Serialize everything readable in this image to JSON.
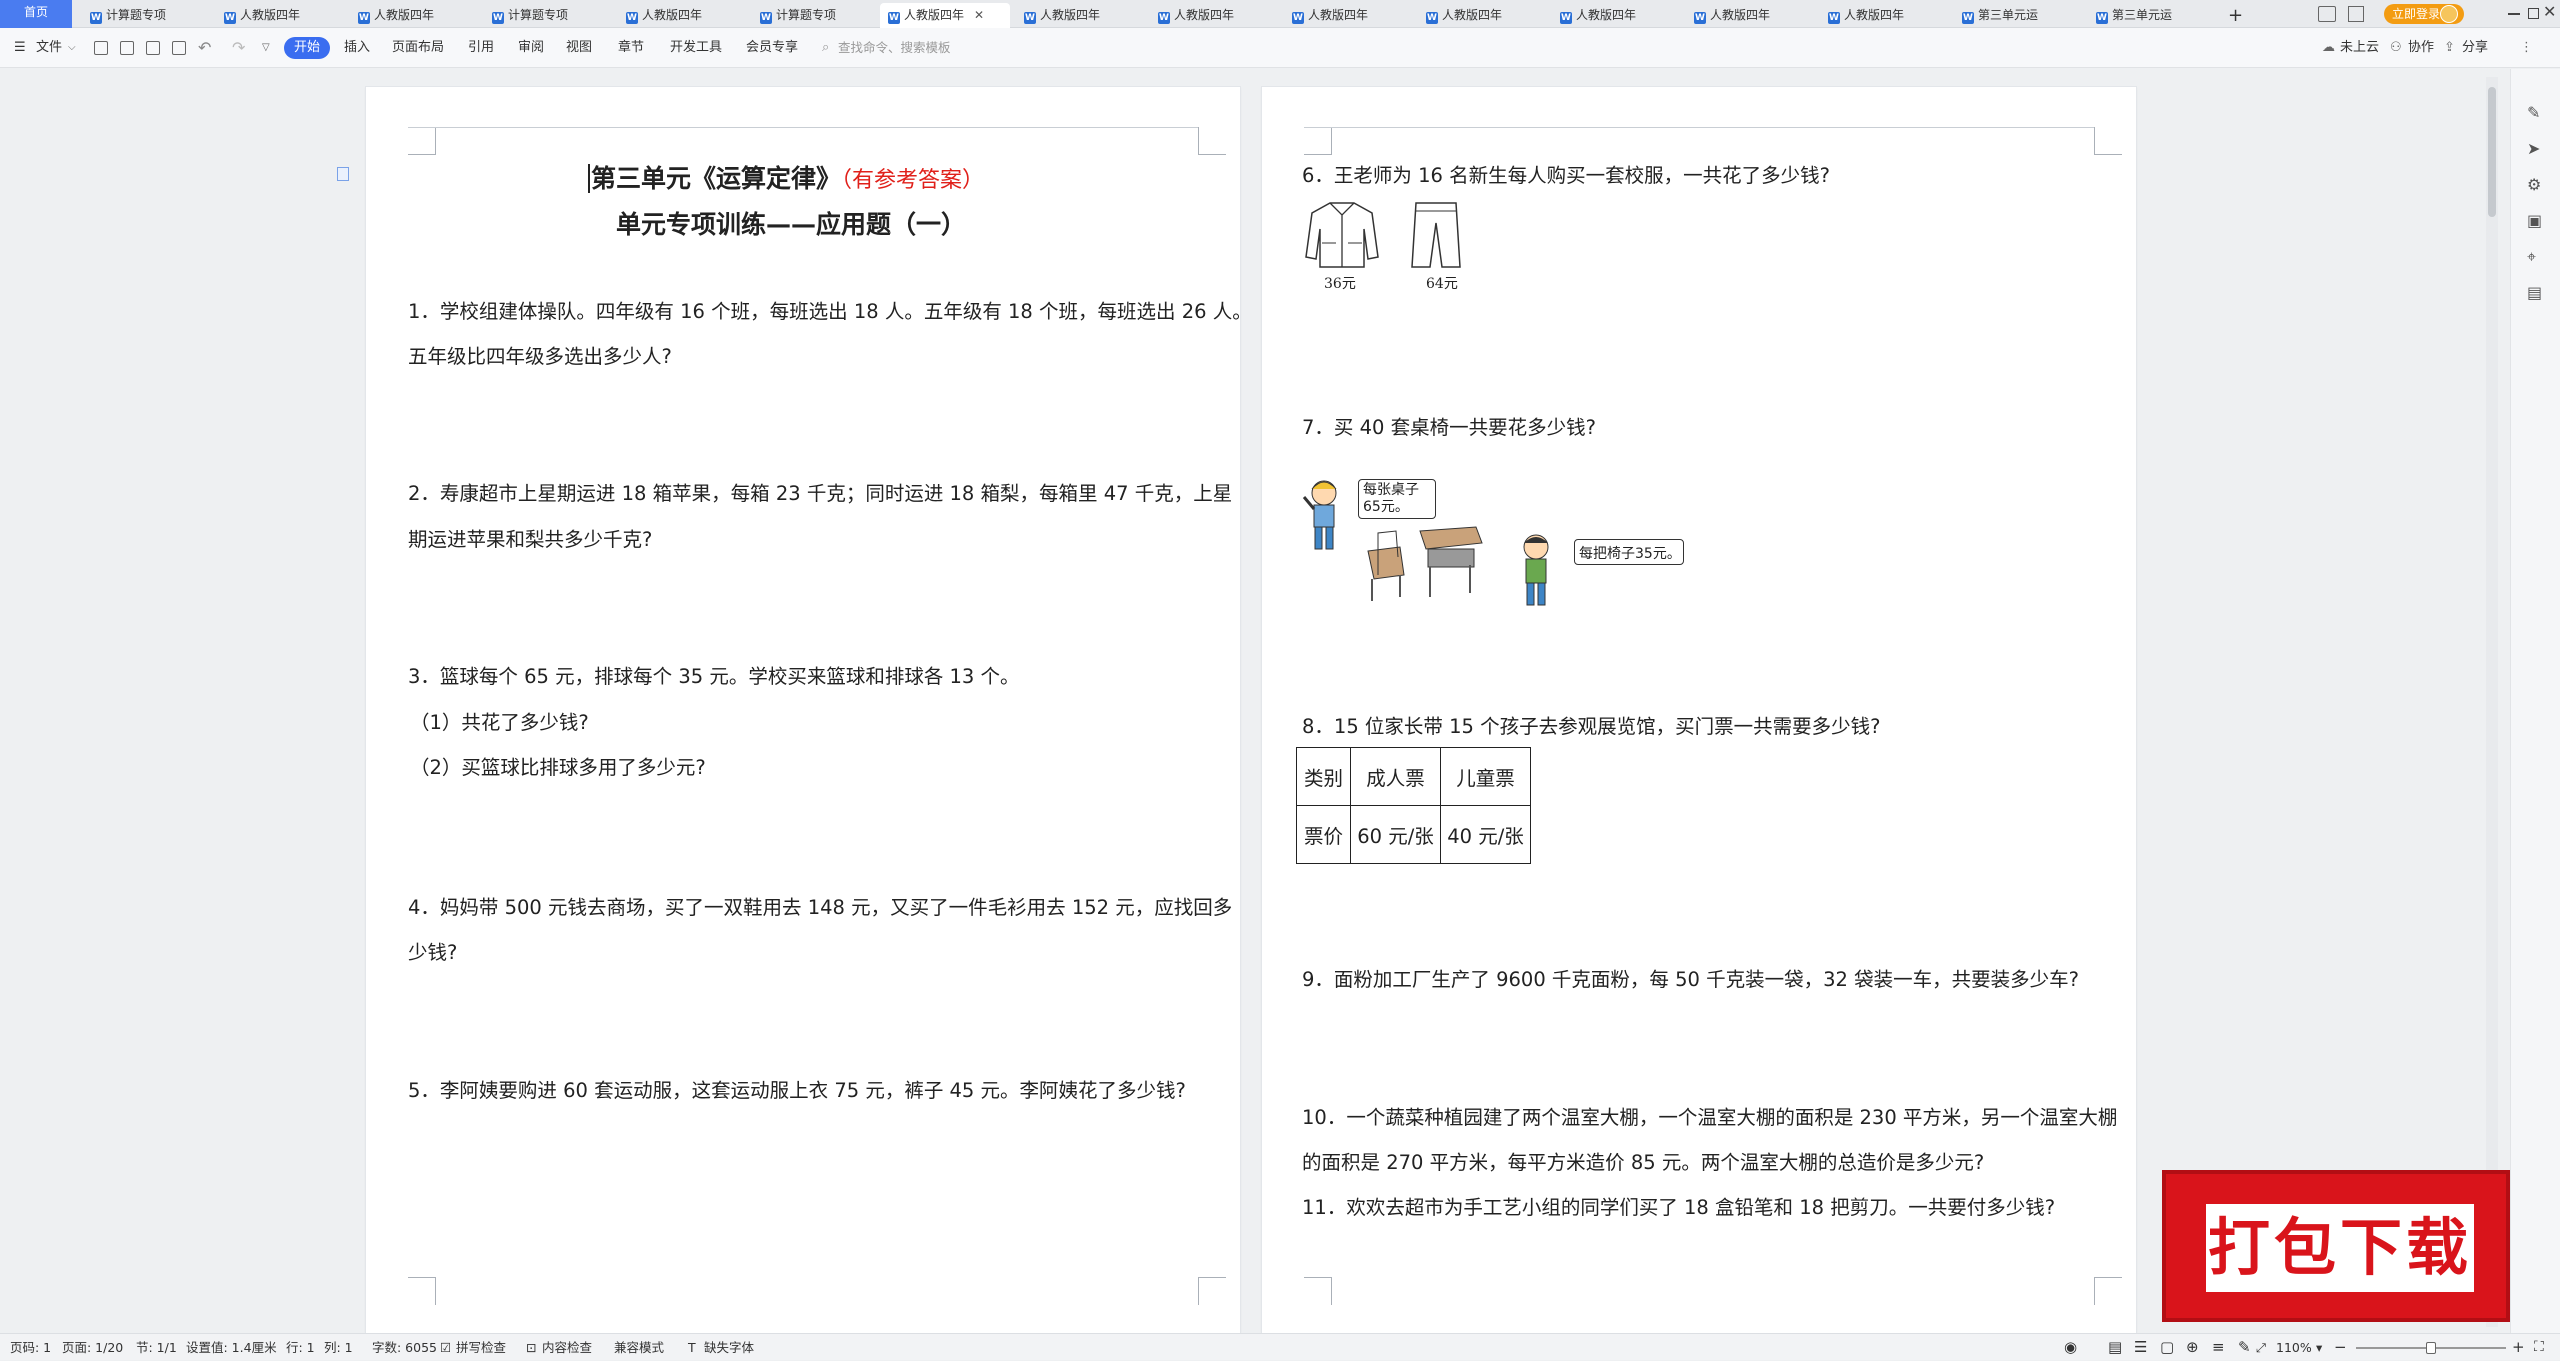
{
  "tabs": {
    "home": "首页",
    "items": [
      {
        "label": "计算题专项"
      },
      {
        "label": "人教版四年"
      },
      {
        "label": "人教版四年"
      },
      {
        "label": "计算题专项"
      },
      {
        "label": "人教版四年"
      },
      {
        "label": "计算题专项"
      },
      {
        "label": "人教版四年"
      },
      {
        "label": "人教版四年"
      },
      {
        "label": "人教版四年"
      },
      {
        "label": "人教版四年"
      },
      {
        "label": "人教版四年"
      },
      {
        "label": "人教版四年"
      },
      {
        "label": "人教版四年"
      },
      {
        "label": "人教版四年"
      },
      {
        "label": "第三单元运"
      },
      {
        "label": "第三单元运"
      }
    ],
    "add": "+",
    "login": "立即登录"
  },
  "toolbar": {
    "file": "文件",
    "start": "开始",
    "menus": [
      "插入",
      "页面布局",
      "引用",
      "审阅",
      "视图",
      "章节",
      "开发工具",
      "会员专享"
    ],
    "search_placeholder": "查找命令、搜索模板",
    "cloud": "未上云",
    "collab": "协作",
    "share": "分享"
  },
  "doc": {
    "title_main": "第三单元《运算定律》",
    "title_answer": "（有参考答案）",
    "subtitle": "单元专项训练——应用题（一）",
    "left_lines": [
      "1．学校组建体操队。四年级有 16 个班，每班选出 18 人。五年级有 18 个班，每班选出 26 人。",
      "五年级比四年级多选出多少人?",
      "2．寿康超市上星期运进 18 箱苹果，每箱 23 千克；同时运进 18 箱梨，每箱里 47 千克，上星",
      "期运进苹果和梨共多少千克?",
      "3．篮球每个 65 元，排球每个 35 元。学校买来篮球和排球各 13 个。",
      "（1）共花了多少钱?",
      "（2）买篮球比排球多用了多少元?",
      "4．妈妈带 500 元钱去商场，买了一双鞋用去 148 元，又买了一件毛衫用去 152 元，应找回多",
      "少钱?",
      "5．李阿姨要购进 60 套运动服，这套运动服上衣 75 元，裤子 45 元。李阿姨花了多少钱?"
    ],
    "q6": "6．王老师为 16 名新生每人购买一套校服，一共花了多少钱?",
    "jacket_price": "36元",
    "pants_price": "64元",
    "q7": "7．买 40 套桌椅一共要花多少钱?",
    "bubble_desk": "每张桌子65元。",
    "bubble_chair": "每把椅子35元。",
    "q8": "8．15 位家长带 15 个孩子去参观展览馆，买门票一共需要多少钱?",
    "table": {
      "h0": "类别",
      "h1": "成人票",
      "h2": "儿童票",
      "r0": "票价",
      "r1": "60 元/张",
      "r2": "40 元/张"
    },
    "q9": "9．面粉加工厂生产了 9600 千克面粉，每 50 千克装一袋，32 袋装一车，共要装多少车?",
    "q10a": "10．一个蔬菜种植园建了两个温室大棚，一个温室大棚的面积是 230 平方米，另一个温室大棚",
    "q10b": "的面积是 270 平方米，每平方米造价 85 元。两个温室大棚的总造价是多少元?",
    "q11": "11．欢欢去超市为手工艺小组的同学们买了 18 盒铅笔和 18 把剪刀。一共要付多少钱?"
  },
  "banner": "打包下载",
  "status": {
    "page_code": "页码: 1",
    "pages": "页面: 1/20",
    "section": "节: 1/1",
    "setting": "设置值: 1.4厘米",
    "row": "行: 1",
    "col": "列: 1",
    "words": "字数: 6055",
    "spell": "拼写检查",
    "content_check": "内容检查",
    "compat": "兼容模式",
    "missing_font": "缺失字体",
    "zoom": "110%"
  },
  "colors": {
    "accent": "#3a6df0",
    "answer_red": "#e0201a",
    "banner_red": "#d9141b"
  }
}
